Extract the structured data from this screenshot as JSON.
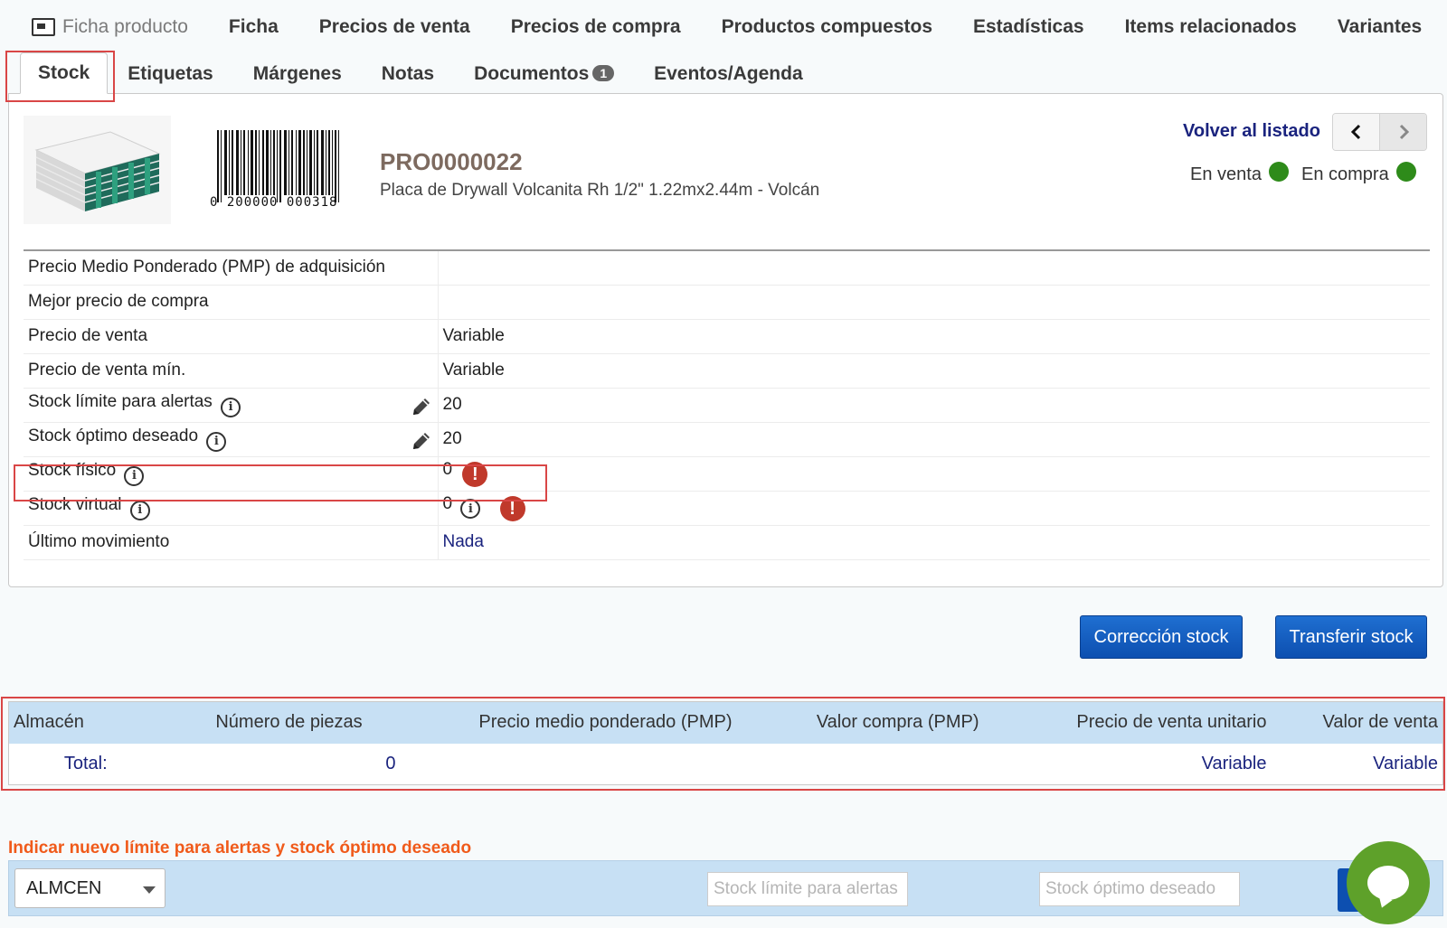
{
  "tabs_primary": {
    "ficha_producto": "Ficha producto",
    "items": [
      "Ficha",
      "Precios de venta",
      "Precios de compra",
      "Productos compuestos",
      "Estadísticas",
      "Items relacionados",
      "Variantes"
    ]
  },
  "tabs_secondary": {
    "active": "Stock",
    "items": [
      "Etiquetas",
      "Márgenes",
      "Notas"
    ],
    "documentos": "Documentos",
    "documentos_count": "1",
    "eventos": "Eventos/Agenda"
  },
  "product": {
    "barcode_text": "0 200000 000318",
    "ref": "PRO0000022",
    "label": "Placa de Drywall Volcanita Rh 1/2\" 1.22mx2.44m - Volcán",
    "back_link": "Volver al listado",
    "status_sale": "En venta",
    "status_purchase": "En compra",
    "status_color": "#2e8b1a"
  },
  "info_rows": {
    "pmp": {
      "label": "Precio Medio Ponderado (PMP) de adquisición",
      "value": ""
    },
    "best_buy": {
      "label": "Mejor precio de compra",
      "value": ""
    },
    "sale_price": {
      "label": "Precio de venta",
      "value": "Variable"
    },
    "sale_price_min": {
      "label": "Precio de venta mín.",
      "value": "Variable"
    },
    "stock_alert": {
      "label": "Stock límite para alertas",
      "value": "20"
    },
    "stock_optimal": {
      "label": "Stock óptimo deseado",
      "value": "20"
    },
    "stock_physical": {
      "label": "Stock físico",
      "value": "0"
    },
    "stock_virtual": {
      "label": "Stock virtual",
      "value": "0"
    },
    "last_movement": {
      "label": "Último movimiento",
      "value": "Nada"
    }
  },
  "buttons": {
    "correction": "Corrección stock",
    "transfer": "Transferir stock"
  },
  "warehouse_table": {
    "headers": [
      "Almacén",
      "Número de piezas",
      "Precio medio ponderado (PMP)",
      "Valor compra (PMP)",
      "Precio de venta unitario",
      "Valor de venta"
    ],
    "total_label": "Total:",
    "total_pieces": "0",
    "total_unit_price": "Variable",
    "total_sale_value": "Variable"
  },
  "form": {
    "title": "Indicar nuevo límite para alertas y stock óptimo deseado",
    "warehouse_selected": "ALMCEN",
    "alert_placeholder": "Stock límite para alertas",
    "optimal_placeholder": "Stock óptimo deseado"
  },
  "colors": {
    "accent_blue": "#0d4fb0",
    "alert_red": "#c0392b",
    "form_title_orange": "#f05a1a",
    "table_header_bg": "#c7e0f4",
    "chat_green": "#5ea12a"
  }
}
